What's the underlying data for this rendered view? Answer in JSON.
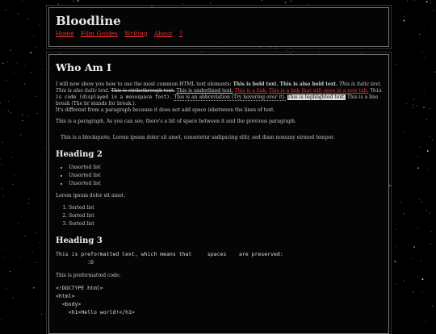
{
  "site": {
    "title": "Bloodline",
    "nav": [
      "Home",
      "Film Guides",
      "Writing",
      "About",
      "?"
    ]
  },
  "content": {
    "h1": "Who Am I",
    "p1": {
      "intro": "I will now show you how to use the most common HTML text elements: ",
      "bold1": "This is bold text.",
      "bold2": "This is also bold text.",
      "italic1": "This is italic text.",
      "italic2": "This is also italic text.",
      "strike": "This is strikethrough text.",
      "underline": "This is underlined text.",
      "link1": "This is a link.",
      "link2": "This is a link that will open in a new tab.",
      "code": "This is code (displayed in a monospace font).",
      "abbr": "This is an abbreviation (Try hovering over it).",
      "highlight": "This is highlighted text.",
      "linebreak": "This is a line break (The br stands for break.).",
      "after_break": "It's different from a paragraph because it does not add space inbetween the lines of text."
    },
    "p2": "This is a paragraph. As you can see, there's a bit of space between it and the previous paragraph.",
    "blockquote": "This is a blockquote. Lorem ipsum dolor sit amet, consetetur sadipscing elitr, sed diam nonumy eirmod tempor.",
    "h2": "Heading 2",
    "ul": [
      "Unsorted list",
      "Unsorted list",
      "Unsorted list"
    ],
    "p3": "Lorem ipsum dolor sit amet.",
    "ol": [
      "Sorted list",
      "Sorted list",
      "Sorted list"
    ],
    "h3": "Heading 3",
    "pre1": "This is preformatted text, which means that     spaces    are preserved:\n          :D",
    "p4": "This is preformatted code:",
    "pre2": "<!DOCTYPE html>\n<html>\n  <body>\n    <h1>Hello world!</h1>"
  }
}
